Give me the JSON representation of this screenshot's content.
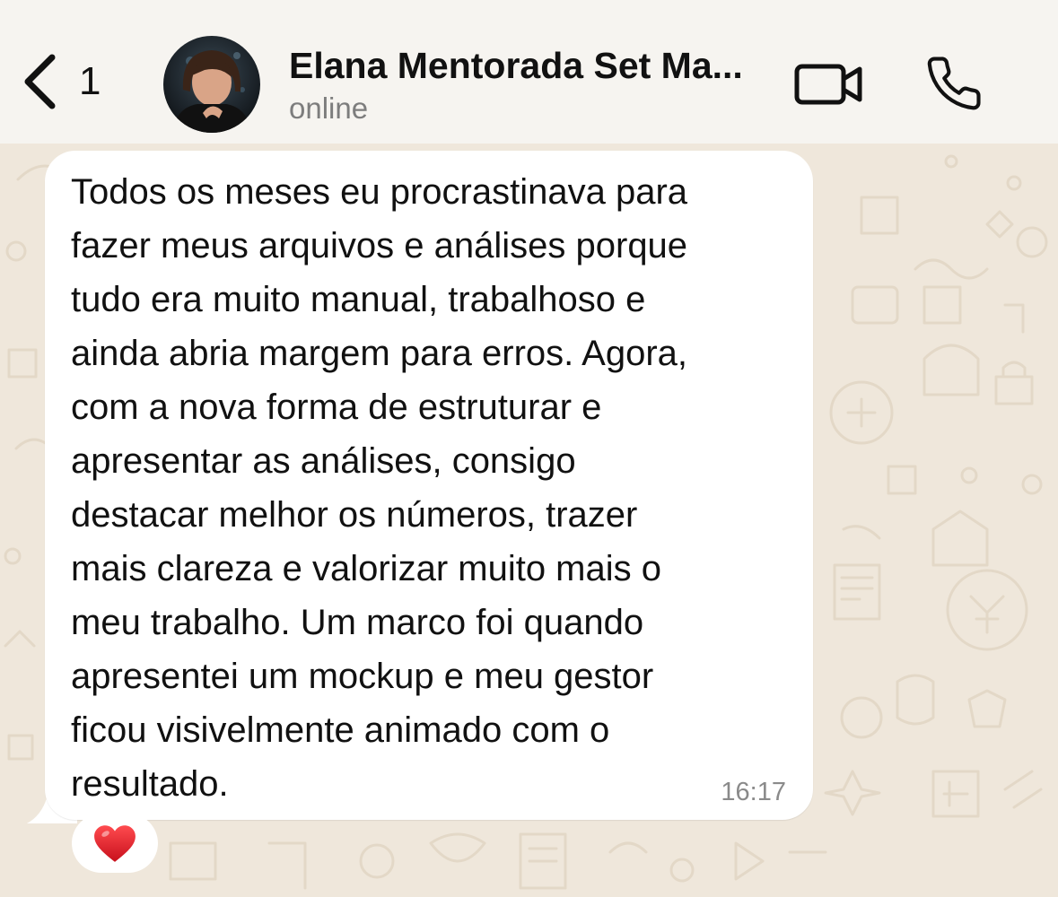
{
  "header": {
    "back_count": "1",
    "contact_name": "Elana Mentorada Set Ma...",
    "status": "online"
  },
  "message": {
    "text": "Todos os meses eu procrastinava para\nfazer meus arquivos e análises porque\ntudo era muito manual, trabalhoso e\nainda abria margem para erros. Agora,\ncom a nova forma de estruturar e\napresentar as análises, consigo\ndestacar melhor os números, trazer\nmais clareza e valorizar muito mais o\nmeu trabalho. Um marco foi quando\napresentei um mockup e meu gestor\nficou visivelmente animado com o\nresultado.",
    "time": "16:17",
    "reaction": "heart-icon"
  },
  "colors": {
    "header_bg": "#f6f4f0",
    "chat_bg": "#efe7db",
    "bubble": "#ffffff",
    "doodle": "#e3d8c7",
    "reaction_heart": "#e0222a"
  }
}
